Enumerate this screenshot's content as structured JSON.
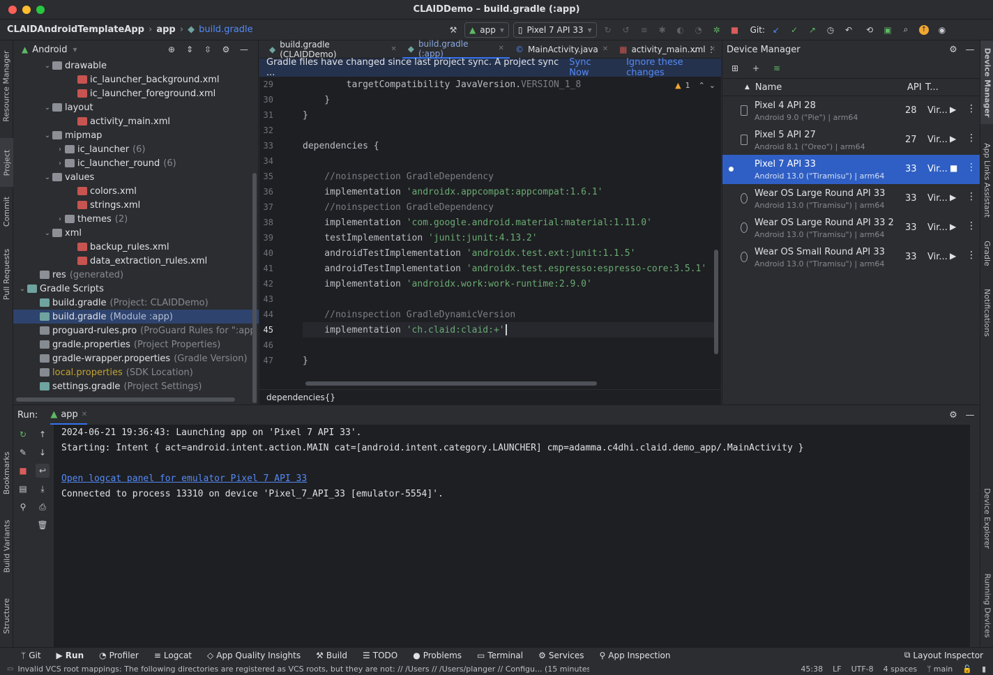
{
  "window": {
    "title": "CLAIDDemo – build.gradle (:app)"
  },
  "nav": {
    "breadcrumb": [
      "CLAIDAndroidTemplateApp",
      "app",
      "build.gradle"
    ],
    "run_config": "app",
    "device": "Pixel 7 API 33",
    "git_label": "Git:"
  },
  "project": {
    "view": "Android",
    "tree": [
      {
        "label": "drawable",
        "extra": "",
        "indent": 2,
        "arrow": "v",
        "icon": "folder"
      },
      {
        "label": "ic_launcher_background.xml",
        "extra": "",
        "indent": 4,
        "arrow": "",
        "icon": "xml"
      },
      {
        "label": "ic_launcher_foreground.xml",
        "extra": "",
        "indent": 4,
        "arrow": "",
        "icon": "xml"
      },
      {
        "label": "layout",
        "extra": "",
        "indent": 2,
        "arrow": "v",
        "icon": "folder"
      },
      {
        "label": "activity_main.xml",
        "extra": "",
        "indent": 4,
        "arrow": "",
        "icon": "xml"
      },
      {
        "label": "mipmap",
        "extra": "",
        "indent": 2,
        "arrow": "v",
        "icon": "folder"
      },
      {
        "label": "ic_launcher",
        "extra": "(6)",
        "indent": 3,
        "arrow": ">",
        "icon": "folder"
      },
      {
        "label": "ic_launcher_round",
        "extra": "(6)",
        "indent": 3,
        "arrow": ">",
        "icon": "folder"
      },
      {
        "label": "values",
        "extra": "",
        "indent": 2,
        "arrow": "v",
        "icon": "folder"
      },
      {
        "label": "colors.xml",
        "extra": "",
        "indent": 4,
        "arrow": "",
        "icon": "xml"
      },
      {
        "label": "strings.xml",
        "extra": "",
        "indent": 4,
        "arrow": "",
        "icon": "xml"
      },
      {
        "label": "themes",
        "extra": "(2)",
        "indent": 3,
        "arrow": ">",
        "icon": "folder"
      },
      {
        "label": "xml",
        "extra": "",
        "indent": 2,
        "arrow": "v",
        "icon": "folder"
      },
      {
        "label": "backup_rules.xml",
        "extra": "",
        "indent": 4,
        "arrow": "",
        "icon": "xml"
      },
      {
        "label": "data_extraction_rules.xml",
        "extra": "",
        "indent": 4,
        "arrow": "",
        "icon": "xml"
      },
      {
        "label": "res",
        "extra": "(generated)",
        "indent": 1,
        "arrow": "",
        "icon": "folder"
      },
      {
        "label": "Gradle Scripts",
        "extra": "",
        "indent": 0,
        "arrow": "v",
        "icon": "grad"
      },
      {
        "label": "build.gradle",
        "extra": "(Project: CLAIDDemo)",
        "indent": 1,
        "arrow": "",
        "icon": "grad"
      },
      {
        "label": "build.gradle",
        "extra": "(Module :app)",
        "indent": 1,
        "arrow": "",
        "icon": "grad",
        "selected": true
      },
      {
        "label": "proguard-rules.pro",
        "extra": "(ProGuard Rules for \":app",
        "indent": 1,
        "arrow": "",
        "icon": "prop"
      },
      {
        "label": "gradle.properties",
        "extra": "(Project Properties)",
        "indent": 1,
        "arrow": "",
        "icon": "prop"
      },
      {
        "label": "gradle-wrapper.properties",
        "extra": "(Gradle Version)",
        "indent": 1,
        "arrow": "",
        "icon": "prop"
      },
      {
        "label": "local.properties",
        "extra": "(SDK Location)",
        "indent": 1,
        "arrow": "",
        "icon": "prop",
        "warn": true
      },
      {
        "label": "settings.gradle",
        "extra": "(Project Settings)",
        "indent": 1,
        "arrow": "",
        "icon": "grad"
      }
    ]
  },
  "left_tabs": [
    "Resource Manager",
    "Project",
    "Commit",
    "Pull Requests",
    "Bookmarks",
    "Build Variants",
    "Structure"
  ],
  "right_tabs": [
    "Device Manager",
    "App Links Assistant",
    "Gradle",
    "Notifications",
    "Device Explorer",
    "Running Devices"
  ],
  "editor": {
    "tabs": [
      {
        "label": "build.gradle (CLAIDDemo)",
        "active": false
      },
      {
        "label": "build.gradle (:app)",
        "active": true
      },
      {
        "label": "MainActivity.java",
        "active": false
      },
      {
        "label": "activity_main.xml",
        "active": false
      }
    ],
    "banner": {
      "message": "Gradle files have changed since last project sync. A project sync ...",
      "sync": "Sync Now",
      "ignore": "Ignore these changes"
    },
    "warning_count": "1",
    "lines": [
      {
        "n": "29",
        "segs": [
          {
            "t": "        targetCompatibility JavaVersion.",
            "c": "kw"
          },
          {
            "t": "VERSION_1_8",
            "c": "cmt"
          }
        ]
      },
      {
        "n": "30",
        "segs": [
          {
            "t": "    }",
            "c": "kw"
          }
        ]
      },
      {
        "n": "31",
        "segs": [
          {
            "t": "}",
            "c": "kw"
          }
        ]
      },
      {
        "n": "32",
        "segs": []
      },
      {
        "n": "33",
        "segs": [
          {
            "t": "dependencies {",
            "c": "kw"
          }
        ]
      },
      {
        "n": "34",
        "segs": []
      },
      {
        "n": "35",
        "segs": [
          {
            "t": "    //noinspection GradleDependency",
            "c": "cmt"
          }
        ]
      },
      {
        "n": "36",
        "segs": [
          {
            "t": "    implementation ",
            "c": "kw"
          },
          {
            "t": "'androidx.appcompat:appcompat:1.6.1'",
            "c": "str"
          }
        ]
      },
      {
        "n": "37",
        "segs": [
          {
            "t": "    //noinspection GradleDependency",
            "c": "cmt"
          }
        ]
      },
      {
        "n": "38",
        "segs": [
          {
            "t": "    implementation ",
            "c": "kw"
          },
          {
            "t": "'com.google.android.material:material:1.11.0'",
            "c": "str"
          }
        ]
      },
      {
        "n": "39",
        "segs": [
          {
            "t": "    testImplementation ",
            "c": "kw"
          },
          {
            "t": "'junit:junit:4.13.2'",
            "c": "str"
          }
        ]
      },
      {
        "n": "40",
        "segs": [
          {
            "t": "    androidTestImplementation ",
            "c": "kw"
          },
          {
            "t": "'androidx.test.ext:junit:1.1.5'",
            "c": "str"
          }
        ]
      },
      {
        "n": "41",
        "segs": [
          {
            "t": "    androidTestImplementation ",
            "c": "kw"
          },
          {
            "t": "'androidx.test.espresso:espresso-core:3.5.1'",
            "c": "str"
          }
        ]
      },
      {
        "n": "42",
        "segs": [
          {
            "t": "    implementation ",
            "c": "kw"
          },
          {
            "t": "'androidx.work:work-runtime:2.9.0'",
            "c": "str"
          }
        ]
      },
      {
        "n": "43",
        "segs": []
      },
      {
        "n": "44",
        "segs": [
          {
            "t": "    //noinspection GradleDynamicVersion",
            "c": "cmt"
          }
        ]
      },
      {
        "n": "45",
        "segs": [
          {
            "t": "    implementation ",
            "c": "kw"
          },
          {
            "t": "'ch.claid:claid:+'",
            "c": "str"
          }
        ]
      },
      {
        "n": "46",
        "segs": []
      },
      {
        "n": "47",
        "segs": [
          {
            "t": "}",
            "c": "kw"
          }
        ]
      }
    ],
    "breadcrumb": "dependencies{}"
  },
  "device_manager": {
    "title": "Device Manager",
    "columns": {
      "name": "Name",
      "api": "API",
      "type": "T..."
    },
    "devices": [
      {
        "name": "Pixel 4 API 28",
        "sub": "Android 9.0 (\"Pie\") | arm64",
        "api": "28",
        "type": "Vir...",
        "selected": false
      },
      {
        "name": "Pixel 5 API 27",
        "sub": "Android 8.1 (\"Oreo\") | arm64",
        "api": "27",
        "type": "Vir...",
        "selected": false
      },
      {
        "name": "Pixel 7 API 33",
        "sub": "Android 13.0 (\"Tiramisu\") | arm64",
        "api": "33",
        "type": "Vir...",
        "selected": true
      },
      {
        "name": "Wear OS Large Round API 33",
        "sub": "Android 13.0 (\"Tiramisu\") | arm64",
        "api": "33",
        "type": "Vir...",
        "selected": false
      },
      {
        "name": "Wear OS Large Round API 33 2",
        "sub": "Android 13.0 (\"Tiramisu\") | arm64",
        "api": "33",
        "type": "Vir...",
        "selected": false
      },
      {
        "name": "Wear OS Small Round API 33",
        "sub": "Android 13.0 (\"Tiramisu\") | arm64",
        "api": "33",
        "type": "Vir...",
        "selected": false
      }
    ]
  },
  "run": {
    "label": "Run:",
    "tab": "app",
    "lines": [
      {
        "text": "2024-06-21 19:36:43: Launching app on 'Pixel 7 API 33'.",
        "link": false
      },
      {
        "text": "Starting: Intent { act=android.intent.action.MAIN cat=[android.intent.category.LAUNCHER] cmp=adamma.c4dhi.claid.demo_app/.MainActivity }",
        "link": false
      },
      {
        "text": "",
        "link": false
      },
      {
        "text": "Open logcat panel for emulator Pixel 7 API 33",
        "link": true
      },
      {
        "text": "Connected to process 13310 on device 'Pixel_7_API_33 [emulator-5554]'.",
        "link": false
      }
    ]
  },
  "bottom_tools": [
    "Git",
    "Run",
    "Profiler",
    "Logcat",
    "App Quality Insights",
    "Build",
    "TODO",
    "Problems",
    "Terminal",
    "Services",
    "App Inspection"
  ],
  "layout_inspector": "Layout Inspector",
  "status": {
    "message": "Invalid VCS root mappings: The following directories are registered as VCS roots, but they are not: // /Users // /Users/planger // Configu... (15 minutes ago)",
    "position": "45:38",
    "line_sep": "LF",
    "encoding": "UTF-8",
    "indent": "4 spaces",
    "branch": "main"
  },
  "colors": {
    "accent": "#3574f0",
    "selection": "#2f5fc4",
    "banner": "#25324d",
    "string": "#6aab73",
    "comment": "#7a7e85"
  }
}
